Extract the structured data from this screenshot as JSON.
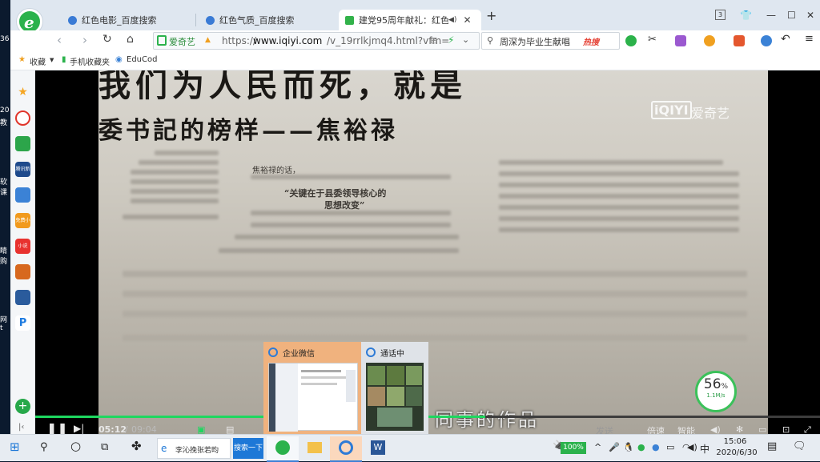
{
  "desktop": {
    "left_labels": [
      "36",
      "20",
      "教",
      "软",
      "课",
      "睛",
      "购",
      "网",
      "t"
    ]
  },
  "tabs": [
    {
      "label": "红色电影_百度搜索"
    },
    {
      "label": "红色气质_百度搜索"
    },
    {
      "label": "建党95周年献礼：红色气质"
    }
  ],
  "window_controls": {
    "counter": "3",
    "new_tab": "+"
  },
  "address": {
    "site_badge": "爱奇艺",
    "url_prefix": "https://",
    "url_domain": "www.iqiyi.com",
    "url_path": "/v_19rrlkjmq4.html?vfm="
  },
  "search": {
    "query": "周深为毕业生献唱",
    "hot_label": "热搜"
  },
  "bookmarks": [
    {
      "label": "收藏"
    },
    {
      "label": "手机收藏夹"
    },
    {
      "label": "EduCod"
    }
  ],
  "sidebar": [
    {
      "name": "favorites-icon",
      "color": "#f5a623",
      "text": "★"
    },
    {
      "name": "weibo-icon",
      "color": "#e0352b",
      "text": ""
    },
    {
      "name": "mail-icon",
      "color": "#2ca54a",
      "text": ""
    },
    {
      "name": "news-app-icon",
      "color": "#1e4a8c",
      "text": "腾讯新闻"
    },
    {
      "name": "docs-icon",
      "color": "#3b82d6",
      "text": ""
    },
    {
      "name": "novel-icon",
      "color": "#f19a1e",
      "text": "免费小说"
    },
    {
      "name": "shop-icon",
      "color": "#e8322f",
      "text": "小说"
    },
    {
      "name": "game-icon",
      "color": "#d7681e",
      "text": ""
    },
    {
      "name": "game2-icon",
      "color": "#2a5b9c",
      "text": ""
    },
    {
      "name": "p-app-icon",
      "color": "#ffffff",
      "text": "P"
    },
    {
      "name": "add-icon",
      "color": "#27a84a",
      "text": "+"
    }
  ],
  "video": {
    "watermark": "爱奇艺",
    "watermark_logo": "iQIYI",
    "headline1": "我们为人民而死，就是",
    "headline2": "委书記的榜样——焦裕禄",
    "quote1": "“关键在于县委领导核心的",
    "quote2": "思想改变”",
    "col_head": "焦裕禄的话，",
    "subtitle": "同事的作品"
  },
  "player": {
    "current_time": "05:12",
    "duration": "09:04",
    "progress_fraction": 0.573,
    "send_label": "发送",
    "speed_label": "倍速",
    "smart_label": "智能"
  },
  "speed_widget": {
    "percent": "56",
    "percent_sign": "%",
    "rate": "1.1M/s"
  },
  "popup": {
    "card1_title": "企业微信",
    "card2_title": "通话中"
  },
  "taskbar": {
    "ie_label": "李沁挽张若昀",
    "search_button": "搜索一下",
    "battery": "100%",
    "ime": "中",
    "time": "15:06",
    "date": "2020/6/30"
  }
}
